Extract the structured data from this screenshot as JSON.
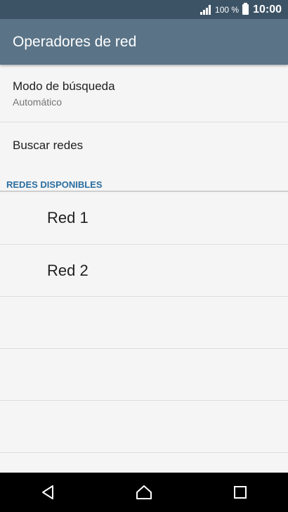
{
  "status_bar": {
    "battery": "100 %",
    "time": "10:00"
  },
  "header": {
    "title": "Operadores de red"
  },
  "settings": {
    "search_mode": {
      "label": "Modo de búsqueda",
      "value": "Automático"
    },
    "search_networks": {
      "label": "Buscar redes"
    }
  },
  "available_networks": {
    "section_title": "REDES DISPONIBLES",
    "items": [
      {
        "label": "Red 1"
      },
      {
        "label": "Red 2"
      }
    ]
  },
  "nav_bar": {
    "icons": [
      "back-icon",
      "home-icon",
      "recents-icon"
    ]
  }
}
